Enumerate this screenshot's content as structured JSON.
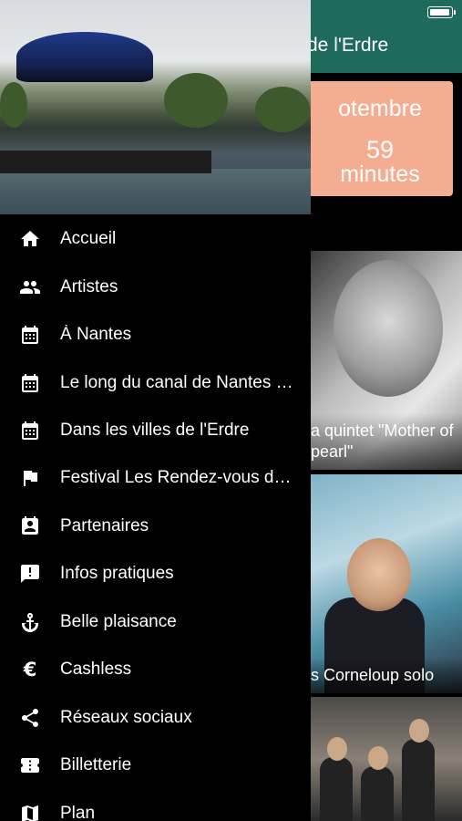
{
  "app": {
    "title": "de l'Erdre",
    "countdown": {
      "month": "otembre",
      "number": "59",
      "unit": "minutes"
    },
    "cards": [
      {
        "caption": "a quintet \"Mother of pearl\""
      },
      {
        "caption": "s Corneloup solo"
      },
      {
        "caption": ""
      }
    ]
  },
  "drawer": {
    "items": [
      {
        "label": "Accueil",
        "icon": "home-icon"
      },
      {
        "label": "Artistes",
        "icon": "people-icon"
      },
      {
        "label": "À Nantes",
        "icon": "calendar-icon"
      },
      {
        "label": "Le long du canal de Nantes à Brest",
        "icon": "calendar-icon"
      },
      {
        "label": "Dans les villes de l'Erdre",
        "icon": "calendar-icon"
      },
      {
        "label": "Festival Les Rendez-vous de l'Erdre",
        "icon": "flag-icon"
      },
      {
        "label": "Partenaires",
        "icon": "contact-card-icon"
      },
      {
        "label": "Infos pratiques",
        "icon": "info-chat-icon"
      },
      {
        "label": "Belle plaisance",
        "icon": "anchor-icon"
      },
      {
        "label": "Cashless",
        "icon": "euro-icon"
      },
      {
        "label": "Réseaux sociaux",
        "icon": "share-icon"
      },
      {
        "label": "Billetterie",
        "icon": "ticket-icon"
      },
      {
        "label": "Plan",
        "icon": "map-icon"
      }
    ]
  },
  "colors": {
    "header_green": "#1e6b5b",
    "countdown_peach": "#f5ad92",
    "drawer_bg": "#000000"
  }
}
